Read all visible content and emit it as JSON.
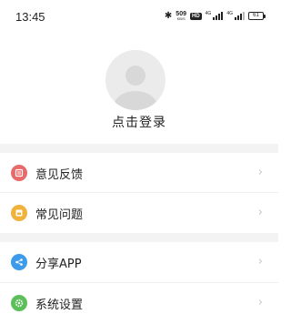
{
  "status_bar": {
    "time": "13:45",
    "net_speed_value": "509",
    "net_speed_unit": "KB/S",
    "hd_label": "HD",
    "net_type_1": "4G",
    "net_type_2": "4G",
    "battery_level": "61"
  },
  "profile": {
    "login_label": "点击登录"
  },
  "menu": {
    "items": [
      {
        "label": "意见反馈",
        "icon": "feedback-icon",
        "color": "#e86a6a"
      },
      {
        "label": "常见问题",
        "icon": "faq-icon",
        "color": "#f0b23a"
      },
      {
        "label": "分享APP",
        "icon": "share-icon",
        "color": "#3d9be9"
      },
      {
        "label": "系统设置",
        "icon": "settings-icon",
        "color": "#5cbf5a"
      }
    ],
    "chevron": "›"
  },
  "colors": {
    "section_gap": "#f3f3f3",
    "avatar_bg": "#ebebeb",
    "chevron": "#c6c6c6"
  }
}
